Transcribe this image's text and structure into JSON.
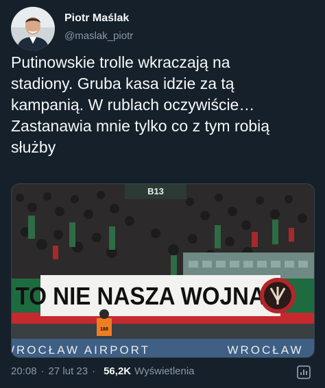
{
  "author": {
    "name": "Piotr Maślak",
    "handle": "@maslak_piotr"
  },
  "tweet": {
    "text": "Putinowskie trolle wkraczają na\nstadiony. Gruba kasa idzie za tą\nkampanią. W rublach oczywiście…\nZastanawia mnie tylko co z tym robią\nsłużby"
  },
  "media": {
    "stand_sign": "B13",
    "banner_text": "TO NIE NASZA WOJNA",
    "ad_board_left": "WROCŁAW AIRPORT",
    "ad_board_right": "WROCŁAW",
    "steward_number": "188"
  },
  "meta": {
    "time": "20:08",
    "date": "27 lut 23",
    "views_count": "56,2K",
    "views_label": "Wyświetlenia"
  },
  "icons": {
    "analytics": "analytics-icon"
  }
}
